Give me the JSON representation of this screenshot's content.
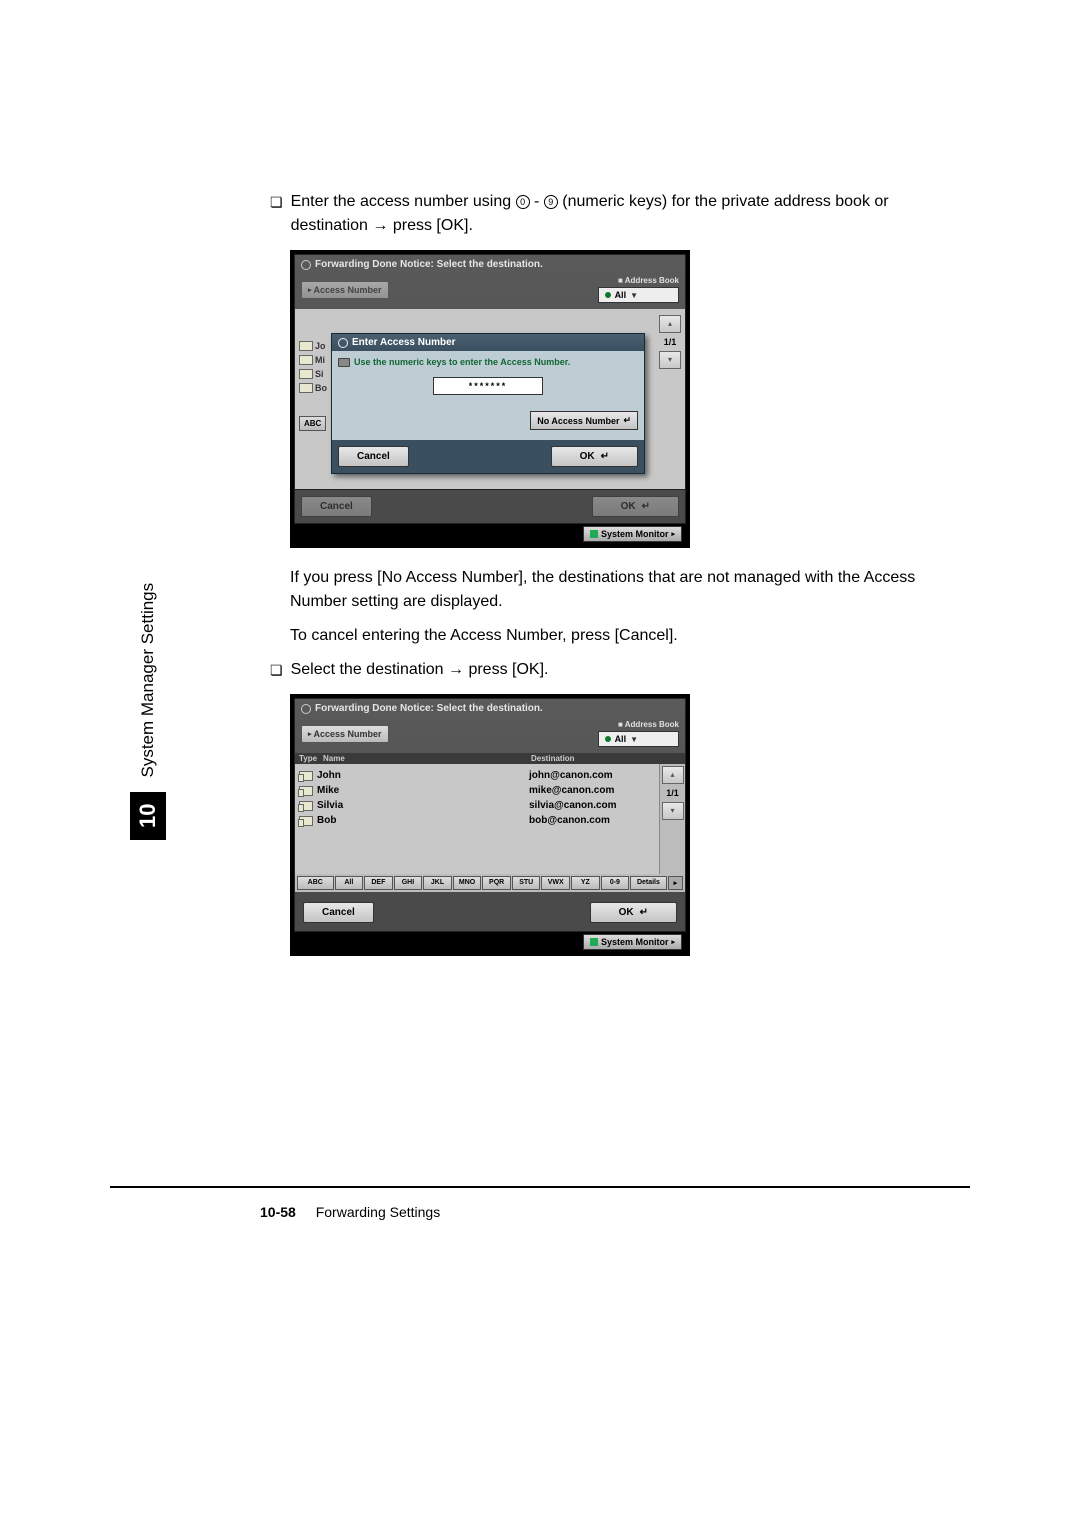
{
  "instruction1_prefix": "Enter the access number using ",
  "instruction1_mid": " - ",
  "instruction1_suffix": " (numeric keys) for the private address book or destination ",
  "instruction1_arrow": "→",
  "instruction1_end": " press [OK].",
  "screen1": {
    "title": "Forwarding Done Notice: Select the destination.",
    "access_number_label": "Access Number",
    "address_book_label": "Address Book",
    "address_book_value": "All",
    "modal_title": "Enter Access Number",
    "modal_hint": "Use the numeric keys to enter the Access Number.",
    "modal_input": "*******",
    "no_access_btn": "No Access Number",
    "cancel": "Cancel",
    "ok": "OK",
    "abc": "ABC",
    "page": "1/1",
    "bg_rows": [
      "Jo",
      "Mi",
      "Si",
      "Bo"
    ],
    "sysmon": "System Monitor"
  },
  "para1": "If you press [No Access Number], the destinations that are not managed with the Access Number setting are displayed.",
  "para2": "To cancel entering the Access Number, press [Cancel].",
  "instruction2_prefix": "Select the destination ",
  "instruction2_arrow": "→",
  "instruction2_end": " press [OK].",
  "screen2": {
    "title": "Forwarding Done Notice: Select the destination.",
    "access_number_label": "Access Number",
    "address_book_label": "Address Book",
    "address_book_value": "All",
    "col_name": "Name",
    "col_dest": "Destination",
    "rows": [
      {
        "name": "John",
        "dest": "john@canon.com"
      },
      {
        "name": "Mike",
        "dest": "mike@canon.com"
      },
      {
        "name": "Silvia",
        "dest": "silvia@canon.com"
      },
      {
        "name": "Bob",
        "dest": "bob@canon.com"
      }
    ],
    "page": "1/1",
    "alpha": [
      "ABC",
      "All",
      "DEF",
      "GHI",
      "JKL",
      "MNO",
      "PQR",
      "STU",
      "VWX",
      "YZ",
      "0-9",
      "Details"
    ],
    "cancel": "Cancel",
    "ok": "OK",
    "sysmon": "System Monitor"
  },
  "sidebar_label": "System Manager Settings",
  "sidebar_num": "10",
  "footer_page": "10-58",
  "footer_title": "Forwarding Settings"
}
